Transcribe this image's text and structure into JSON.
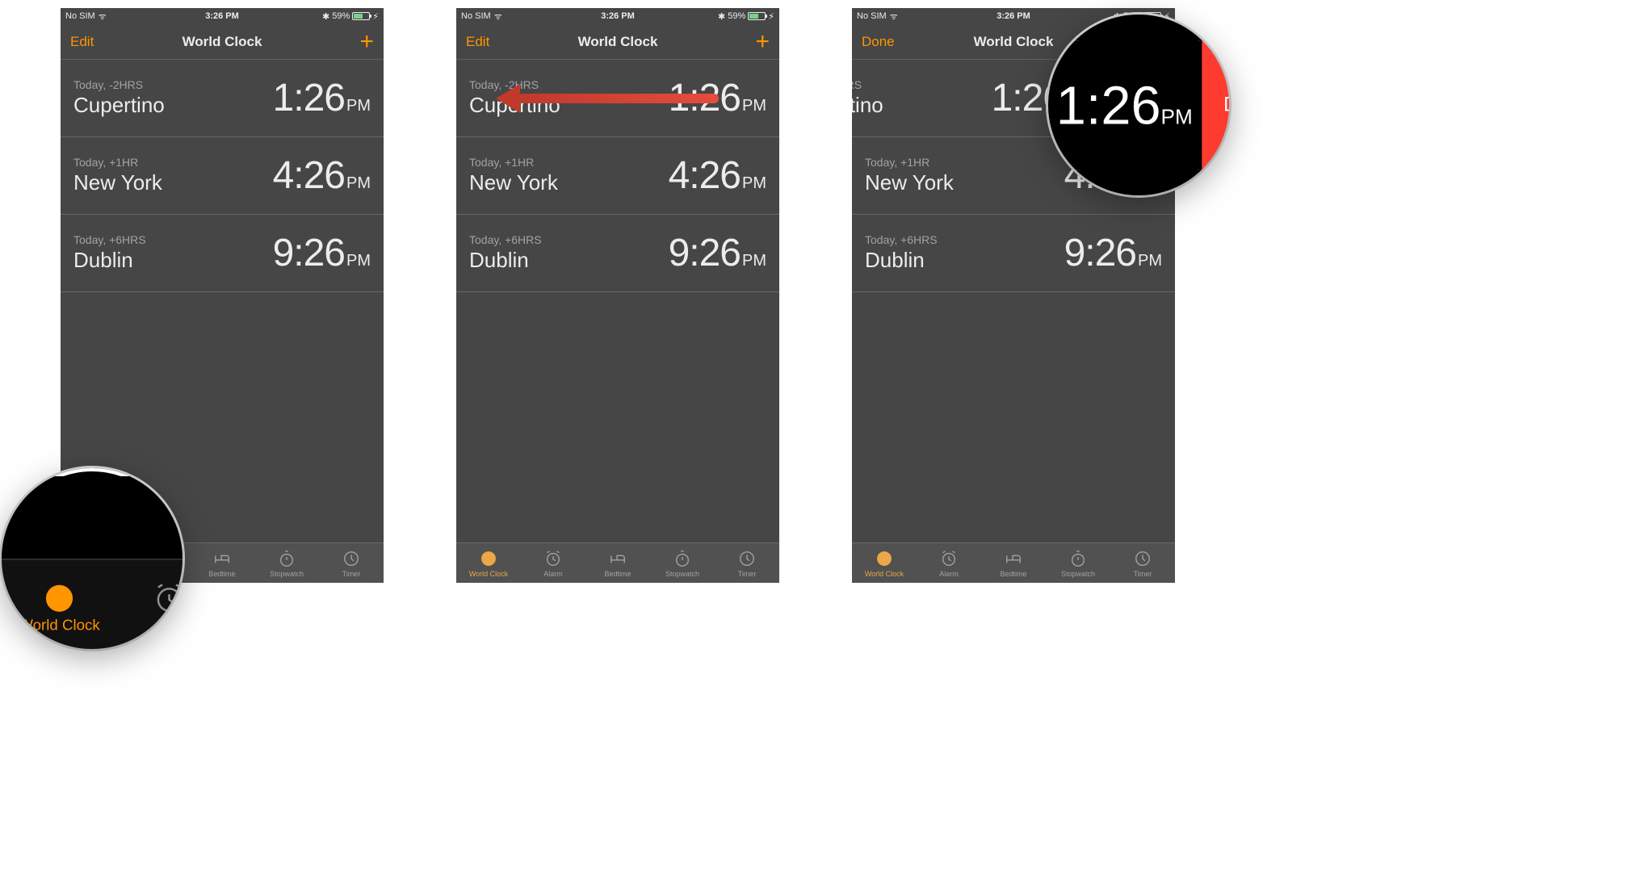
{
  "status": {
    "carrier": "No SIM",
    "time": "3:26 PM",
    "battery_pct": "59%"
  },
  "screens": [
    {
      "nav": {
        "left": "Edit",
        "title": "World Clock",
        "right": "+"
      }
    },
    {
      "nav": {
        "left": "Edit",
        "title": "World Clock",
        "right": "+"
      }
    },
    {
      "nav": {
        "left": "Done",
        "title": "World Clock",
        "right": "+"
      },
      "row0_shifted": true,
      "delete_label": "Delete"
    }
  ],
  "clocks": [
    {
      "offset": "Today, -2HRS",
      "city": "Cupertino",
      "time": "1:26",
      "ampm": "PM"
    },
    {
      "offset": "Today, +1HR",
      "city": "New York",
      "time": "4:26",
      "ampm": "PM"
    },
    {
      "offset": "Today, +6HRS",
      "city": "Dublin",
      "time": "9:26",
      "ampm": "PM"
    }
  ],
  "tabs": [
    {
      "label": "World Clock",
      "active": true
    },
    {
      "label": "Alarm",
      "active": false
    },
    {
      "label": "Bedtime",
      "active": false
    },
    {
      "label": "Stopwatch",
      "active": false
    },
    {
      "label": "Timer",
      "active": false
    }
  ],
  "loupe1_tabs": [
    {
      "label": "World Clock",
      "active": true
    },
    {
      "label": "Ala",
      "active": false
    }
  ],
  "loupe2": {
    "delete_label": "Delete",
    "city": "ertino",
    "time": "1:26",
    "ampm": "PM"
  }
}
